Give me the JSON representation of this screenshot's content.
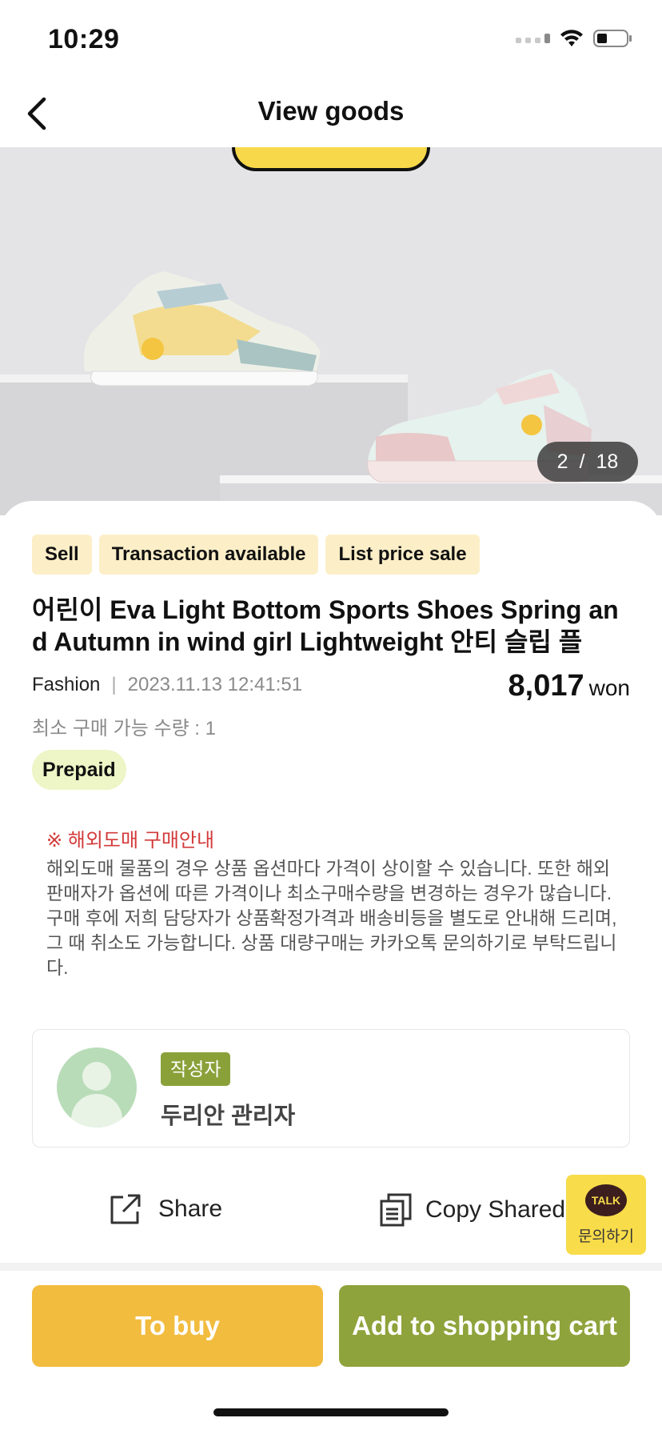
{
  "status_bar": {
    "time": "10:29"
  },
  "header": {
    "title": "View goods"
  },
  "gallery": {
    "current": "2",
    "separator": "/",
    "total": "18"
  },
  "product": {
    "tags": [
      "Sell",
      "Transaction available",
      "List price sale"
    ],
    "title": "어린이 Eva Light Bottom Sports Shoes Spring and Autumn in wind girl Lightweight 안티 슬립 플",
    "category": "Fashion",
    "separator": "|",
    "date": "2023.11.13 12:41:51",
    "price": "8,017",
    "price_unit": "won",
    "min_qty": "최소 구매 가능 수량 : 1",
    "payment_badge": "Prepaid"
  },
  "notice": {
    "title": "※ 해외도매 구매안내",
    "body": "해외도매 물품의 경우 상품 옵션마다 가격이 상이할 수 있습니다. 또한 해외 판매자가 옵션에 따른 가격이나 최소구매수량을 변경하는 경우가 많습니다. 구매 후에 저희 담당자가 상품확정가격과 배송비등을 별도로 안내해 드리며, 그 때 취소도 가능합니다. 상품 대량구매는 카카오톡 문의하기로 부탁드립니다."
  },
  "author": {
    "role": "작성자",
    "name": "두리안 관리자"
  },
  "actions": {
    "share": "Share",
    "copy": "Copy Shared"
  },
  "kakao": {
    "bubble": "TALK",
    "label": "문의하기"
  },
  "bottom": {
    "buy": "To buy",
    "cart": "Add to shopping cart"
  },
  "colors": {
    "buy": "#f2bc3f",
    "cart": "#8ea33b",
    "tag_bg": "#fcefc8",
    "notice_red": "#d33a3a",
    "kakao": "#f8dc4a"
  }
}
